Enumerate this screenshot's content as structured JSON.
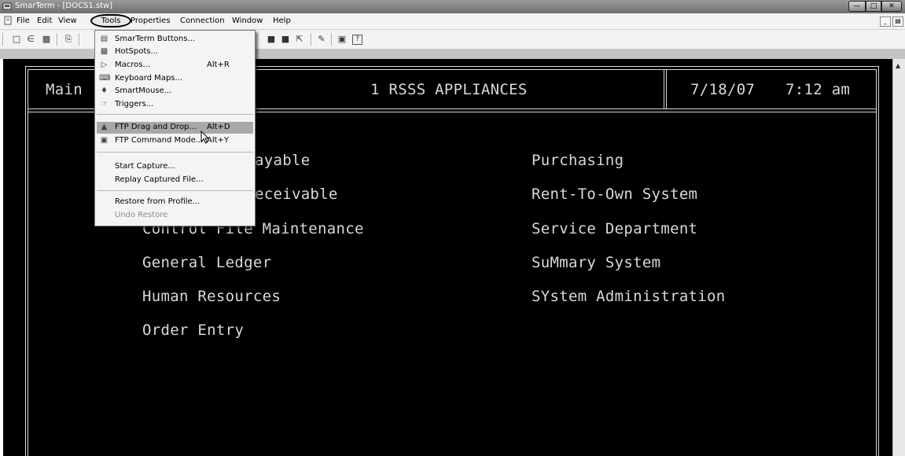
{
  "window": {
    "title": "SmarTerm - [DOCS1.stw]"
  },
  "menubar": {
    "items": [
      "File",
      "Edit",
      "View",
      "Tools",
      "Properties",
      "Connection",
      "Window",
      "Help"
    ]
  },
  "tools_menu": {
    "items": [
      {
        "label": "SmarTerm Buttons...",
        "shortcut": "",
        "icon": "buttons-icon"
      },
      {
        "label": "HotSpots...",
        "shortcut": "",
        "icon": "hotspots-icon"
      },
      {
        "label": "Macros...",
        "shortcut": "Alt+R",
        "icon": "macro-play-icon"
      },
      {
        "label": "Keyboard Maps...",
        "shortcut": "",
        "icon": "keyboard-icon"
      },
      {
        "label": "SmartMouse...",
        "shortcut": "",
        "icon": "mouse-icon"
      },
      {
        "label": "Triggers...",
        "shortcut": "",
        "icon": "trigger-hand-icon"
      },
      {
        "label": "FTP Drag and Drop...",
        "shortcut": "Alt+D",
        "icon": "ftp-drag-icon"
      },
      {
        "label": "FTP Command Mode...",
        "shortcut": "Alt+Y",
        "icon": "ftp-command-icon"
      },
      {
        "label": "Start Capture...",
        "shortcut": ""
      },
      {
        "label": "Replay Captured File...",
        "shortcut": ""
      },
      {
        "label": "Restore from Profile...",
        "shortcut": ""
      },
      {
        "label": "Undo Restore",
        "shortcut": "",
        "disabled": true
      }
    ],
    "highlighted": "FTP Drag and Drop..."
  },
  "terminal": {
    "header": {
      "left": "Main",
      "center": "1 RSSS APPLIANCES",
      "date": "7/18/07",
      "time": "7:12 am"
    },
    "left_column": [
      "ayable",
      "eceivable",
      "Control File Maintenance",
      "General Ledger",
      "Human Resources",
      "Order Entry"
    ],
    "right_column": [
      "Purchasing",
      "Rent-To-Own System",
      "Service Department",
      "SuMmary System",
      "SYstem Administration"
    ]
  },
  "colors": {
    "terminal_bg": "#000000",
    "terminal_fg": "#d8d8d8",
    "highlight": "#a8a8a8"
  }
}
